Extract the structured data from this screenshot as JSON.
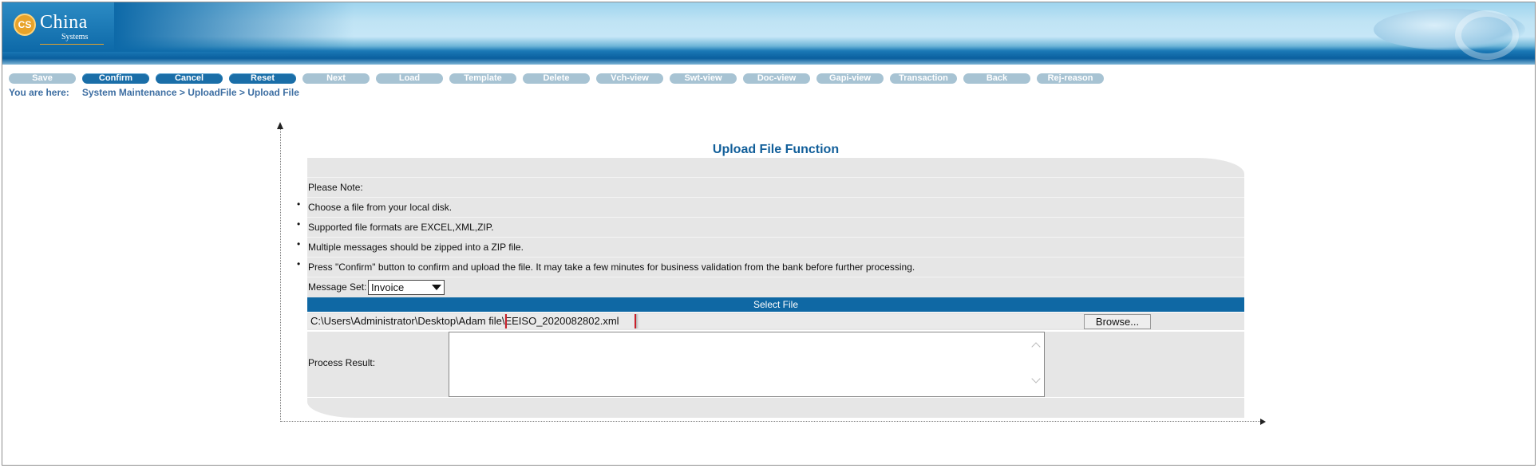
{
  "header": {
    "logo_badge": "CS",
    "logo_word": "China",
    "logo_sub": "Systems"
  },
  "toolbar": {
    "buttons": [
      {
        "label": "Save",
        "enabled": false
      },
      {
        "label": "Confirm",
        "enabled": true
      },
      {
        "label": "Cancel",
        "enabled": true
      },
      {
        "label": "Reset",
        "enabled": true
      },
      {
        "label": "Next",
        "enabled": false
      },
      {
        "label": "Load",
        "enabled": false
      },
      {
        "label": "Template",
        "enabled": false
      },
      {
        "label": "Delete",
        "enabled": false
      },
      {
        "label": "Vch-view",
        "enabled": false
      },
      {
        "label": "Swt-view",
        "enabled": false
      },
      {
        "label": "Doc-view",
        "enabled": false
      },
      {
        "label": "Gapi-view",
        "enabled": false
      },
      {
        "label": "Transaction",
        "enabled": false
      },
      {
        "label": "Back",
        "enabled": false
      },
      {
        "label": "Rej-reason",
        "enabled": false
      }
    ]
  },
  "breadcrumb": {
    "prefix": "You are here:",
    "path": "System Maintenance > UploadFile > Upload File"
  },
  "form": {
    "title": "Upload File Function",
    "note_heading": "Please Note:",
    "notes": [
      "Choose a file from your local disk.",
      "Supported file formats are EXCEL,XML,ZIP.",
      "Multiple messages should be zipped into a ZIP file.",
      "Press \"Confirm\" button to confirm and upload the file. It may take a few minutes for business validation from the bank before further processing."
    ],
    "message_set_label": "Message Set:",
    "message_set_value": "Invoice",
    "select_file_header": "Select File",
    "file_path_prefix": "C:\\Users\\Administrator\\Desktop\\Adam file\\",
    "file_name": "EEISO_2020082802.xml",
    "browse_label": "Browse...",
    "process_result_label": "Process Result:",
    "process_result_value": ""
  },
  "colors": {
    "accent": "#125f9a",
    "toolbar_enabled": "#1a6ea8",
    "toolbar_disabled": "#a7c3d3",
    "panel_bg": "#e6e6e6",
    "highlight_border": "#c8202a"
  }
}
